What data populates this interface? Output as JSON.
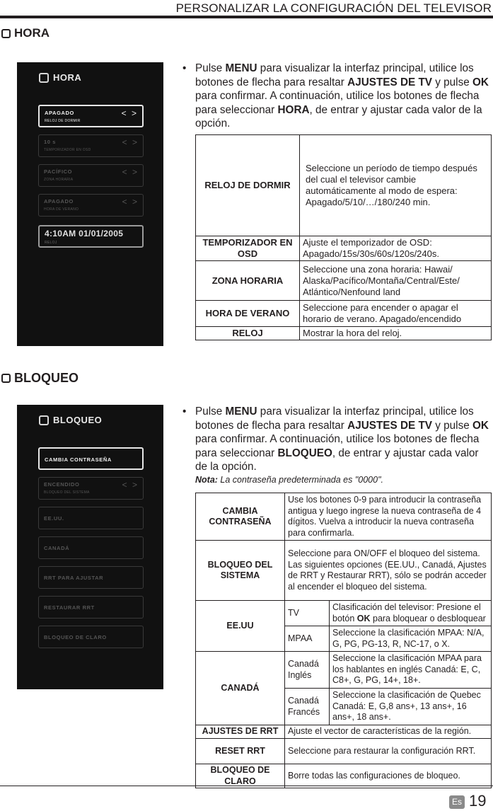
{
  "header": {
    "title": "PERSONALIZAR LA CONFIGURACIÓN DEL TELEVISOR"
  },
  "hora": {
    "heading": "HORA",
    "tv_screen": {
      "title": "HORA",
      "items": [
        {
          "label": "APAGADO",
          "sub": "RELOJ DE DORMIR",
          "arrows": "< >",
          "state": "active"
        },
        {
          "label": "10 s",
          "sub": "TEMPORIZADOR EN OSD",
          "arrows": "< >",
          "state": "dim"
        },
        {
          "label": "PACÍFICO",
          "sub": "ZONA HORARIA",
          "arrows": "< >",
          "state": "dim"
        },
        {
          "label": "APAGADO",
          "sub": "HORA DE VERANO",
          "arrows": "< >",
          "state": "dim"
        },
        {
          "label": "4:10AM 01/01/2005",
          "sub": "RELOJ",
          "state": "clock"
        }
      ]
    },
    "instructions": {
      "bullet": "•",
      "parts": [
        "Pulse ",
        "MENU",
        " para visualizar la interfaz principal, utilice los botones de flecha para resaltar  ",
        "AJUSTES DE TV",
        " y pulse ",
        "OK",
        " para confirmar. A continuación, utilice los botones de flecha para seleccionar ",
        "HORA",
        ", de entrar y ajustar cada valor de la opción."
      ]
    },
    "table": [
      {
        "key": "RELOJ DE DORMIR",
        "value": "Seleccione un período de tiempo después del cual el televisor cambie automáticamente al modo de espera: Apagado/5/10/…/180/240 min."
      },
      {
        "key": "TEMPORIZADOR EN OSD",
        "value": "Ajuste el temporizador de OSD: Apagado/15s/30s/60s/120s/240s."
      },
      {
        "key": "ZONA HORARIA",
        "value": "Seleccione una zona horaria: Hawai/ Alaska/Pacífico/Montaña/Central/Este/ Atlántico/Nenfound land"
      },
      {
        "key": "HORA DE VERANO",
        "value": "Seleccione para encender o apagar el horario de verano. Apagado/encendido"
      },
      {
        "key": "RELOJ",
        "value": "Mostrar la hora del reloj."
      }
    ]
  },
  "bloqueo": {
    "heading": "BLOQUEO",
    "tv_screen": {
      "title": "BLOQUEO",
      "items": [
        {
          "label": "CAMBIA CONTRASEÑA",
          "state": "active"
        },
        {
          "label": "ENCENDIDO",
          "sub": "BLOQUEO DEL SISTEMA",
          "arrows": "< >",
          "state": "dim"
        },
        {
          "label": "EE.UU.",
          "state": "dim"
        },
        {
          "label": "CANADÁ",
          "state": "dim"
        },
        {
          "label": "RRT PARA AJUSTAR",
          "state": "dim"
        },
        {
          "label": "RESTAURAR RRT",
          "state": "dim"
        },
        {
          "label": "BLOQUEO DE CLARO",
          "state": "dim"
        }
      ]
    },
    "instructions": {
      "bullet": "•",
      "parts": [
        "Pulse ",
        "MENU",
        " para visualizar la interfaz principal, utilice los botones de flecha para resaltar  ",
        "AJUSTES DE TV",
        " y pulse ",
        "OK",
        " para confirmar. A continuación, utilice los botones de flecha para seleccionar ",
        "BLOQUEO",
        ", de entrar y ajustar cada valor de la opción."
      ],
      "note_label": "Nota:",
      "note_text": " La contraseña predeterminada es \"0000\"."
    },
    "table": {
      "cambia": {
        "key": "CAMBIA CONTRASEÑA",
        "value": "Use los botones 0-9 para introducir la contraseña antigua y luego ingrese la nueva contraseña de 4 dígitos. Vuelva a introducir la nueva contraseña para confirmarla."
      },
      "sistema": {
        "key": "BLOQUEO DEL SISTEMA",
        "value": "Seleccione para ON/OFF el bloqueo del sistema. Las siguientes opciones (EE.UU., Canadá, Ajustes de RRT y Restaurar RRT), sólo se podrán acceder al encender el bloqueo del sistema."
      },
      "eeuu": {
        "key": "EE.UU",
        "rows": [
          {
            "sub": "TV",
            "value_pre": "Clasificación del televisor: Presione el botón ",
            "value_bold": "OK",
            "value_post": " para bloquear o desbloquear"
          },
          {
            "sub": "MPAA",
            "value": "Seleccione la clasificación MPAA: N/A, G, PG, PG-13, R, NC-17, o X."
          }
        ]
      },
      "canada": {
        "key": "CANADÁ",
        "rows": [
          {
            "sub": "Canadá Inglés",
            "value": "Seleccione la clasificación MPAA para los hablantes en inglés Canadá: E, C, C8+, G, PG, 14+, 18+."
          },
          {
            "sub": "Canadá Francés",
            "value": "Seleccione la clasificación de Quebec Canadá: E, G,8 ans+, 13 ans+, 16 ans+, 18 ans+."
          }
        ]
      },
      "ajustes_rrt": {
        "key": "AJUSTES DE RRT",
        "value": "Ajuste el vector de características de la región."
      },
      "reset_rrt": {
        "key": "RESET RRT",
        "value": "Seleccione para restaurar la configuración RRT."
      },
      "claro": {
        "key": "BLOQUEO DE CLARO",
        "value": "Borre todas las configuraciones de bloqueo."
      }
    }
  },
  "footer": {
    "language": "Es",
    "page_number": "19"
  }
}
